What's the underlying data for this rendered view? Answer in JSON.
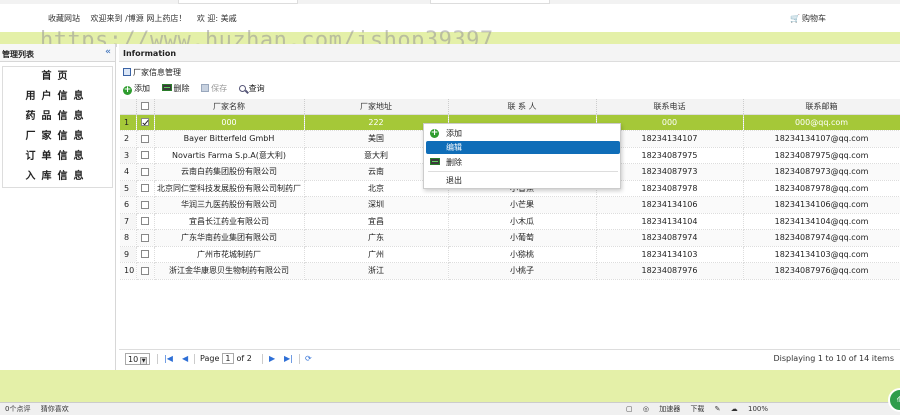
{
  "header": {
    "links": [
      "收藏网站",
      "欢迎来到 /博源 网上药店！",
      "欢 迎: 美戚"
    ],
    "cart_label": "购物车",
    "cart_icon": "cart-icon"
  },
  "watermark": "https://www.huzhan.com/ishop39397",
  "sidebar": {
    "title": "管理列表",
    "collapse_icon": "«",
    "items": [
      {
        "label": "首页"
      },
      {
        "label": "用户信息"
      },
      {
        "label": "药品信息"
      },
      {
        "label": "厂家信息"
      },
      {
        "label": "订单信息"
      },
      {
        "label": "入库信息"
      }
    ]
  },
  "main": {
    "info_title": "Information",
    "panel_title": "厂家信息管理",
    "toolbar": {
      "add": "添加",
      "delete": "删除",
      "save": "保存",
      "search": "查询"
    }
  },
  "grid": {
    "columns": [
      "厂家名称",
      "厂家地址",
      "联 系 人",
      "联系电话",
      "联系邮箱"
    ],
    "rows": [
      {
        "no": "1",
        "name": "000",
        "addr": "222",
        "contact": "",
        "phone": "000",
        "email": "000@qq.com"
      },
      {
        "no": "2",
        "name": "Bayer Bitterfeld GmbH",
        "addr": "美国",
        "contact": "",
        "phone": "18234134107",
        "email": "18234134107@qq.com"
      },
      {
        "no": "3",
        "name": "Novartis Farma S.p.A(意大利)",
        "addr": "意大利",
        "contact": "",
        "phone": "18234087975",
        "email": "18234087975@qq.com"
      },
      {
        "no": "4",
        "name": "云南白药集团股份有限公司",
        "addr": "云南",
        "contact": "",
        "phone": "18234087973",
        "email": "18234087973@qq.com"
      },
      {
        "no": "5",
        "name": "北京同仁堂科技发展股份有限公司制药厂",
        "addr": "北京",
        "contact": "小香蕉",
        "phone": "18234087978",
        "email": "18234087978@qq.com"
      },
      {
        "no": "6",
        "name": "华润三九医药股份有限公司",
        "addr": "深圳",
        "contact": "小芒果",
        "phone": "18234134106",
        "email": "18234134106@qq.com"
      },
      {
        "no": "7",
        "name": "宜昌长江药业有限公司",
        "addr": "宜昌",
        "contact": "小木瓜",
        "phone": "18234134104",
        "email": "18234134104@qq.com"
      },
      {
        "no": "8",
        "name": "广东华南药业集团有限公司",
        "addr": "广东",
        "contact": "小葡萄",
        "phone": "18234087974",
        "email": "18234087974@qq.com"
      },
      {
        "no": "9",
        "name": "广州市花城制药厂",
        "addr": "广州",
        "contact": "小猕桃",
        "phone": "18234134103",
        "email": "18234134103@qq.com"
      },
      {
        "no": "10",
        "name": "浙江金华康恩贝生物制药有限公司",
        "addr": "浙江",
        "contact": "小桃子",
        "phone": "18234087976",
        "email": "18234087976@qq.com"
      }
    ],
    "selected_row": 1
  },
  "context_menu": {
    "items": [
      "添加",
      "编辑",
      "删除",
      "退出"
    ],
    "hover_index": 1
  },
  "pager": {
    "page_size": "10",
    "page_label": "Page",
    "current_page": "1",
    "of_label": "of 2",
    "info": "Displaying 1 to 10 of 14 items"
  },
  "status_bar": {
    "left": [
      "0个点评",
      "猜你喜欢"
    ],
    "right": [
      "加速器",
      "下载",
      "100%"
    ]
  },
  "colors": {
    "accent_green": "#a5c838",
    "band_green": "#e4f0a8",
    "menu_highlight": "#0f6db8"
  }
}
